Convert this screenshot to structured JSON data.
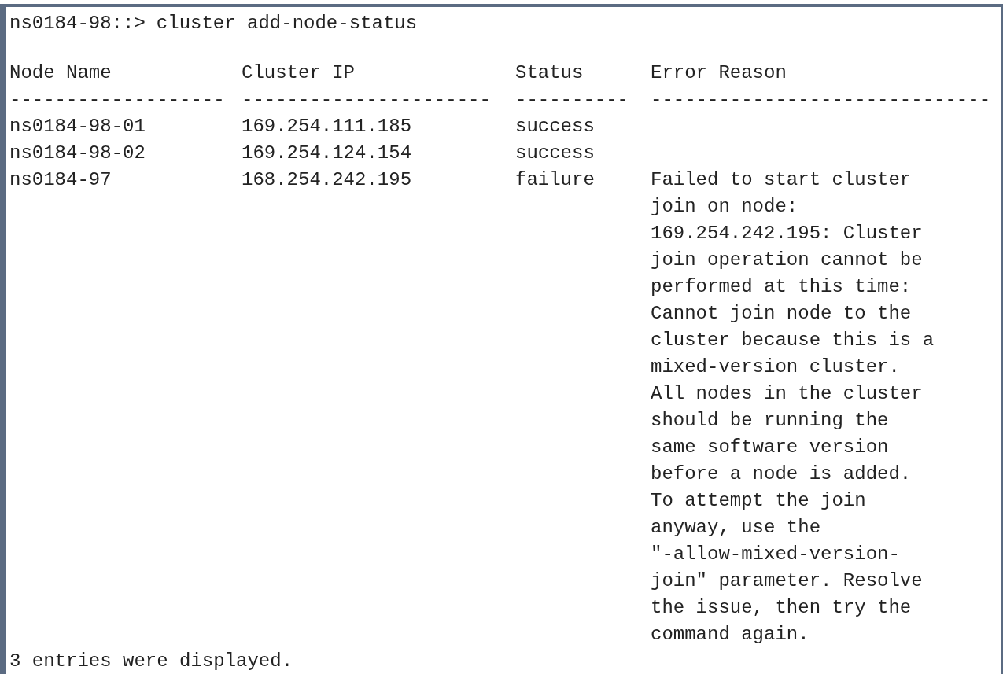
{
  "terminal": {
    "prompt": "ns0184-98::>",
    "command": "cluster add-node-status",
    "columns": [
      "Node Name",
      "Cluster IP",
      "Status",
      "Error Reason"
    ],
    "separators": [
      "-------------------",
      "----------------------",
      "----------",
      "------------------------------"
    ],
    "rows": [
      {
        "node": "ns0184-98-01",
        "ip": "169.254.111.185",
        "status": "success",
        "error": []
      },
      {
        "node": "ns0184-98-02",
        "ip": "169.254.124.154",
        "status": "success",
        "error": []
      },
      {
        "node": "ns0184-97",
        "ip": "168.254.242.195",
        "status": "failure",
        "error": [
          "Failed to start cluster",
          "join on node:",
          "169.254.242.195: Cluster",
          "join operation cannot be",
          "performed at this time:",
          "Cannot join node to the",
          "cluster because this is a",
          "mixed-version cluster.",
          "All nodes in the cluster",
          "should be running the",
          "same software version",
          "before a node is added.",
          "To attempt the join",
          "anyway, use the",
          "\"-allow-mixed-version-",
          "join\" parameter. Resolve",
          "the issue, then try the",
          "command again."
        ]
      }
    ],
    "footer": "3 entries were displayed."
  }
}
